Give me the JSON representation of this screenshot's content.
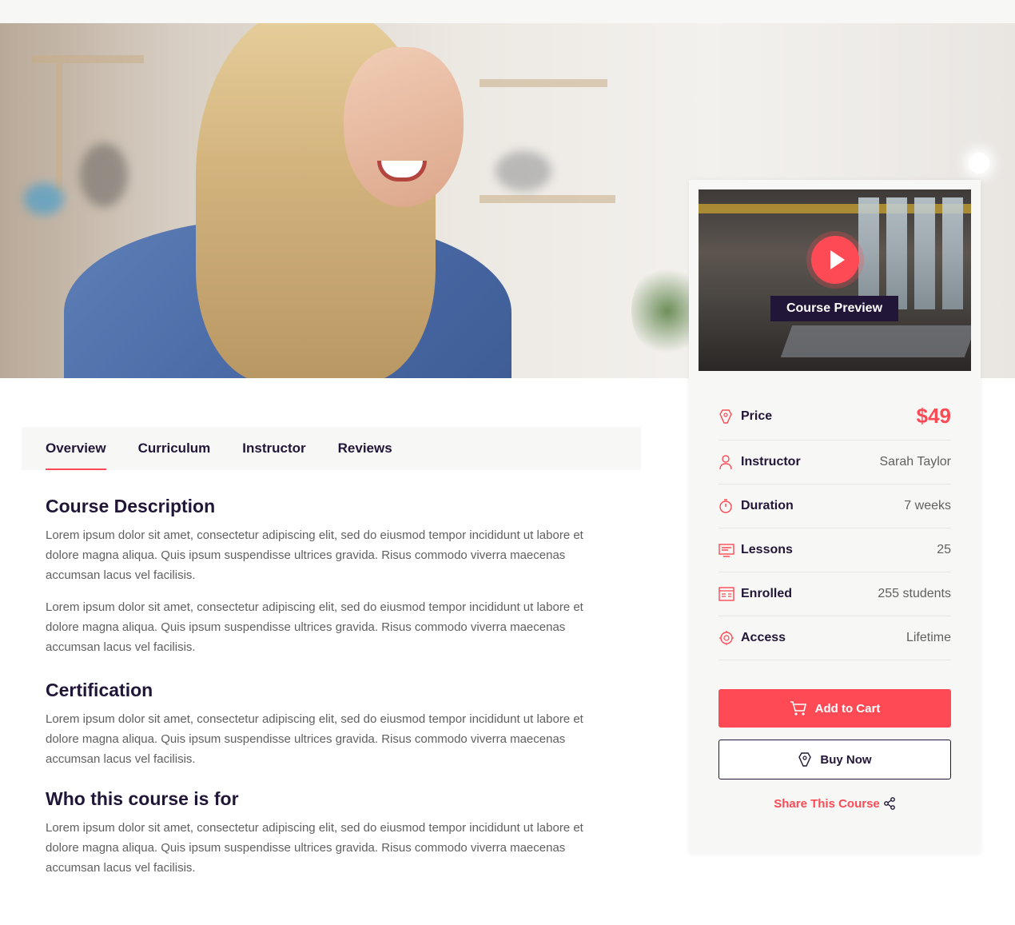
{
  "tabs": [
    {
      "label": "Overview",
      "active": true
    },
    {
      "label": "Curriculum",
      "active": false
    },
    {
      "label": "Instructor",
      "active": false
    },
    {
      "label": "Reviews",
      "active": false
    }
  ],
  "content": {
    "sections": [
      {
        "heading": "Course Description",
        "paragraphs": [
          "Lorem ipsum dolor sit amet, consectetur adipiscing elit, sed do eiusmod tempor incididunt ut labore et dolore magna aliqua. Quis ipsum suspendisse ultrices gravida. Risus commodo viverra maecenas accumsan lacus vel facilisis.",
          "Lorem ipsum dolor sit amet, consectetur adipiscing elit, sed do eiusmod tempor incididunt ut labore et dolore magna aliqua. Quis ipsum suspendisse ultrices gravida. Risus commodo viverra maecenas accumsan lacus vel facilisis."
        ]
      },
      {
        "heading": "Certification",
        "paragraphs": [
          "Lorem ipsum dolor sit amet, consectetur adipiscing elit, sed do eiusmod tempor incididunt ut labore et dolore magna aliqua. Quis ipsum suspendisse ultrices gravida. Risus commodo viverra maecenas accumsan lacus vel facilisis."
        ]
      },
      {
        "heading": "Who this course is for",
        "paragraphs": [
          "Lorem ipsum dolor sit amet, consectetur adipiscing elit, sed do eiusmod tempor incididunt ut labore et dolore magna aliqua. Quis ipsum suspendisse ultrices gravida. Risus commodo viverra maecenas accumsan lacus vel facilisis."
        ]
      }
    ]
  },
  "sidebar": {
    "video_label": "Course Preview",
    "info": [
      {
        "name": "Price",
        "value": "$49",
        "icon": "price-tag-icon"
      },
      {
        "name": "Instructor",
        "value": "Sarah Taylor",
        "icon": "instructor-icon"
      },
      {
        "name": "Duration",
        "value": "7 weeks",
        "icon": "stopwatch-icon"
      },
      {
        "name": "Lessons",
        "value": "25",
        "icon": "lessons-icon"
      },
      {
        "name": "Enrolled",
        "value": "255 students",
        "icon": "enrolled-icon"
      },
      {
        "name": "Access",
        "value": "Lifetime",
        "icon": "access-icon"
      }
    ],
    "add_to_cart": "Add to Cart",
    "buy_now": "Buy Now",
    "share": "Share This Course"
  },
  "colors": {
    "accent": "#fe4a55",
    "heading": "#221638",
    "text": "#606060",
    "panel": "#f7f8f6"
  }
}
